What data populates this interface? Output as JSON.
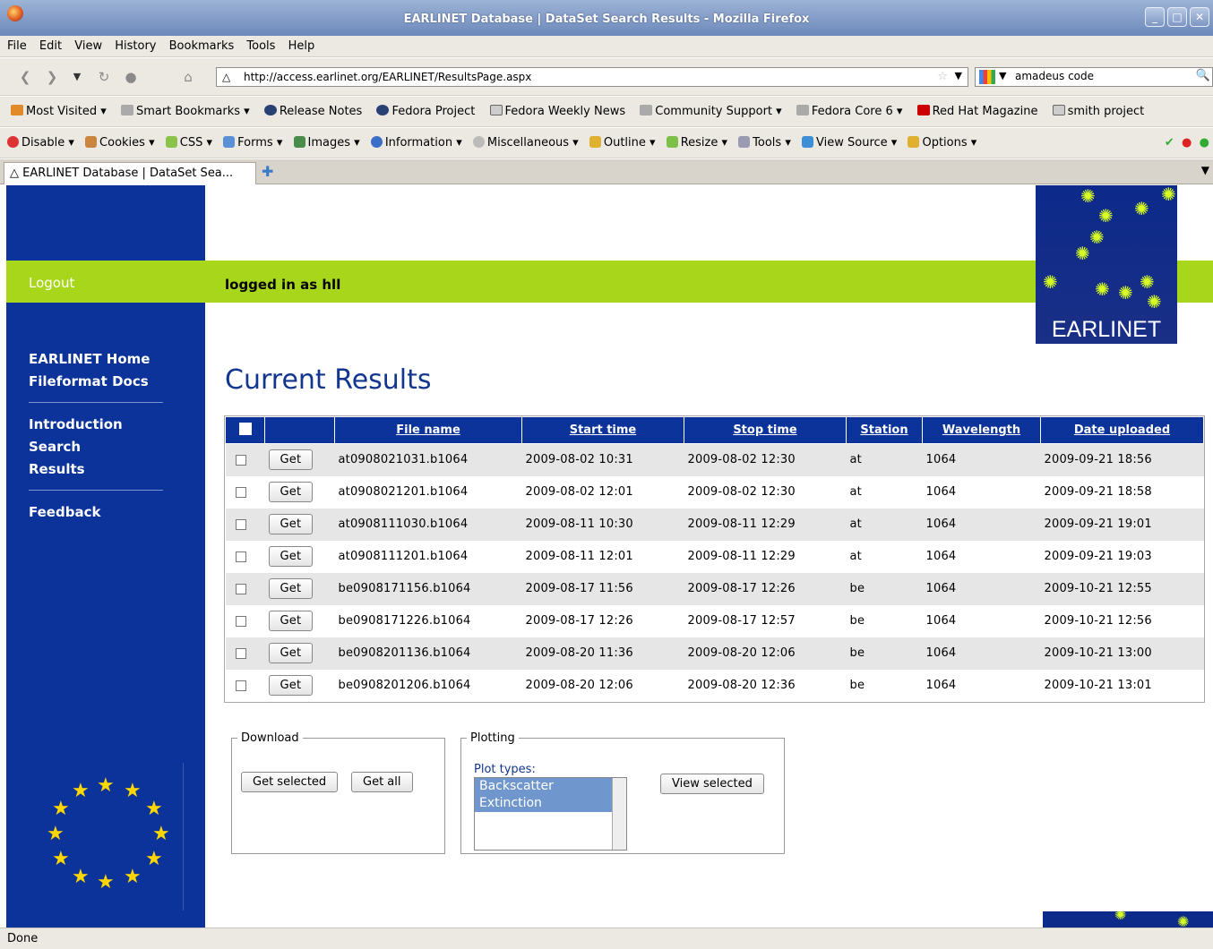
{
  "window": {
    "title": "EARLINET Database | DataSet Search Results - Mozilla Firefox"
  },
  "menu": [
    "File",
    "Edit",
    "View",
    "History",
    "Bookmarks",
    "Tools",
    "Help"
  ],
  "nav": {
    "url": "http://access.earlinet.org/EARLINET/ResultsPage.aspx",
    "search_value": "amadeus code"
  },
  "bookmarks": [
    "Most Visited",
    "Smart Bookmarks",
    "Release Notes",
    "Fedora Project",
    "Fedora Weekly News",
    "Community Support",
    "Fedora Core 6",
    "Red Hat Magazine",
    "smith project"
  ],
  "devtools": [
    "Disable",
    "Cookies",
    "CSS",
    "Forms",
    "Images",
    "Information",
    "Miscellaneous",
    "Outline",
    "Resize",
    "Tools",
    "View Source",
    "Options"
  ],
  "tab": {
    "label": "EARLINET Database | DataSet Sea..."
  },
  "page": {
    "logout": "Logout",
    "logged_in": "logged in as hll",
    "nav_primary": [
      "EARLINET Home",
      "Fileformat Docs"
    ],
    "nav_secondary": [
      "Introduction",
      "Search",
      "Results"
    ],
    "nav_tertiary": [
      "Feedback"
    ],
    "brand": "EARLINET",
    "heading": "Current Results",
    "columns": [
      "File name",
      "Start time",
      "Stop time",
      "Station",
      "Wavelength",
      "Date uploaded"
    ],
    "get_label": "Get",
    "rows": [
      [
        "at0908021031.b1064",
        "2009-08-02 10:31",
        "2009-08-02 12:30",
        "at",
        "1064",
        "2009-09-21 18:56"
      ],
      [
        "at0908021201.b1064",
        "2009-08-02 12:01",
        "2009-08-02 12:30",
        "at",
        "1064",
        "2009-09-21 18:58"
      ],
      [
        "at0908111030.b1064",
        "2009-08-11 10:30",
        "2009-08-11 12:29",
        "at",
        "1064",
        "2009-09-21 19:01"
      ],
      [
        "at0908111201.b1064",
        "2009-08-11 12:01",
        "2009-08-11 12:29",
        "at",
        "1064",
        "2009-09-21 19:03"
      ],
      [
        "be0908171156.b1064",
        "2009-08-17 11:56",
        "2009-08-17 12:26",
        "be",
        "1064",
        "2009-10-21 12:55"
      ],
      [
        "be0908171226.b1064",
        "2009-08-17 12:26",
        "2009-08-17 12:57",
        "be",
        "1064",
        "2009-10-21 12:56"
      ],
      [
        "be0908201136.b1064",
        "2009-08-20 11:36",
        "2009-08-20 12:06",
        "be",
        "1064",
        "2009-10-21 13:00"
      ],
      [
        "be0908201206.b1064",
        "2009-08-20 12:06",
        "2009-08-20 12:36",
        "be",
        "1064",
        "2009-10-21 13:01"
      ]
    ],
    "download": {
      "legend": "Download",
      "get_selected": "Get selected",
      "get_all": "Get all"
    },
    "plotting": {
      "legend": "Plotting",
      "label": "Plot types:",
      "options": [
        "Backscatter",
        "Extinction"
      ],
      "view_selected": "View selected"
    }
  },
  "status": "Done",
  "colors": {
    "sidebar": "#0b3399",
    "accent_bar": "#a8d61a",
    "heading": "#12368f"
  }
}
